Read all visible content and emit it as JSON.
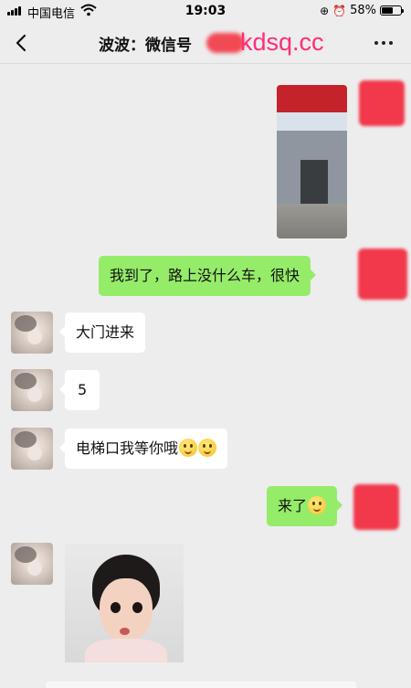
{
  "status_bar": {
    "carrier": "中国电信",
    "time": "19:03",
    "battery_percent": "58%",
    "battery_level": 0.58,
    "icons": [
      "signal-icon",
      "wifi-icon",
      "location-icon",
      "alarm-icon",
      "battery-icon"
    ]
  },
  "header": {
    "title": "波波：微信号",
    "watermark": "kdsq.cc",
    "back_icon": "chevron-left-icon",
    "more_icon": "more-dots-icon"
  },
  "messages": [
    {
      "side": "right",
      "type": "image",
      "content": "street-storefront-photo"
    },
    {
      "side": "right",
      "type": "text",
      "text": "我到了，路上没什么车，很快"
    },
    {
      "side": "left",
      "type": "text",
      "text": "大门进来"
    },
    {
      "side": "left",
      "type": "text",
      "text": "5"
    },
    {
      "side": "left",
      "type": "text",
      "text": "电梯口我等你哦",
      "emojis": [
        "smile-emoji",
        "smile-emoji"
      ]
    },
    {
      "side": "right",
      "type": "text",
      "text": "来了",
      "emojis": [
        "grin-emoji"
      ]
    },
    {
      "side": "left",
      "type": "image",
      "content": "child-portrait-photo"
    }
  ],
  "colors": {
    "background": "#ededed",
    "outgoing_bubble": "#95ec69",
    "incoming_bubble": "#ffffff",
    "watermark": "#ff2d7a",
    "redaction": "#f2384b"
  }
}
